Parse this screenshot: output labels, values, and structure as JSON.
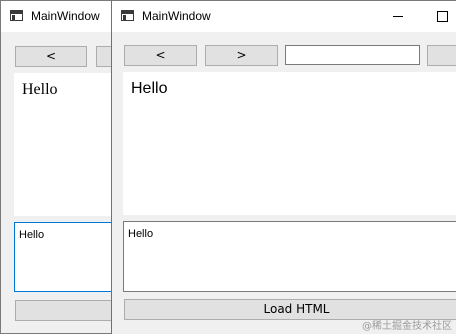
{
  "back_window": {
    "title": "MainWindow",
    "toolbar": {
      "back_label": "<"
    },
    "webview": {
      "heading": "Hello"
    },
    "editor": {
      "text": "Hello"
    }
  },
  "front_window": {
    "title": "MainWindow",
    "toolbar": {
      "back_label": "<",
      "forward_label": ">",
      "url_value": ""
    },
    "webview": {
      "heading": "Hello"
    },
    "editor": {
      "text": "Hello"
    },
    "load_button_label": "Load HTML"
  },
  "watermark": "@稀土掘金技术社区",
  "colors": {
    "window_background": "#f0f0f0",
    "button_face": "#e1e1e1",
    "button_border": "#adadad",
    "focus_border": "#0078d7",
    "content_white": "#ffffff"
  },
  "icons": {
    "app": "window-app-icon",
    "minimize": "minimize-icon",
    "maximize": "maximize-icon"
  }
}
